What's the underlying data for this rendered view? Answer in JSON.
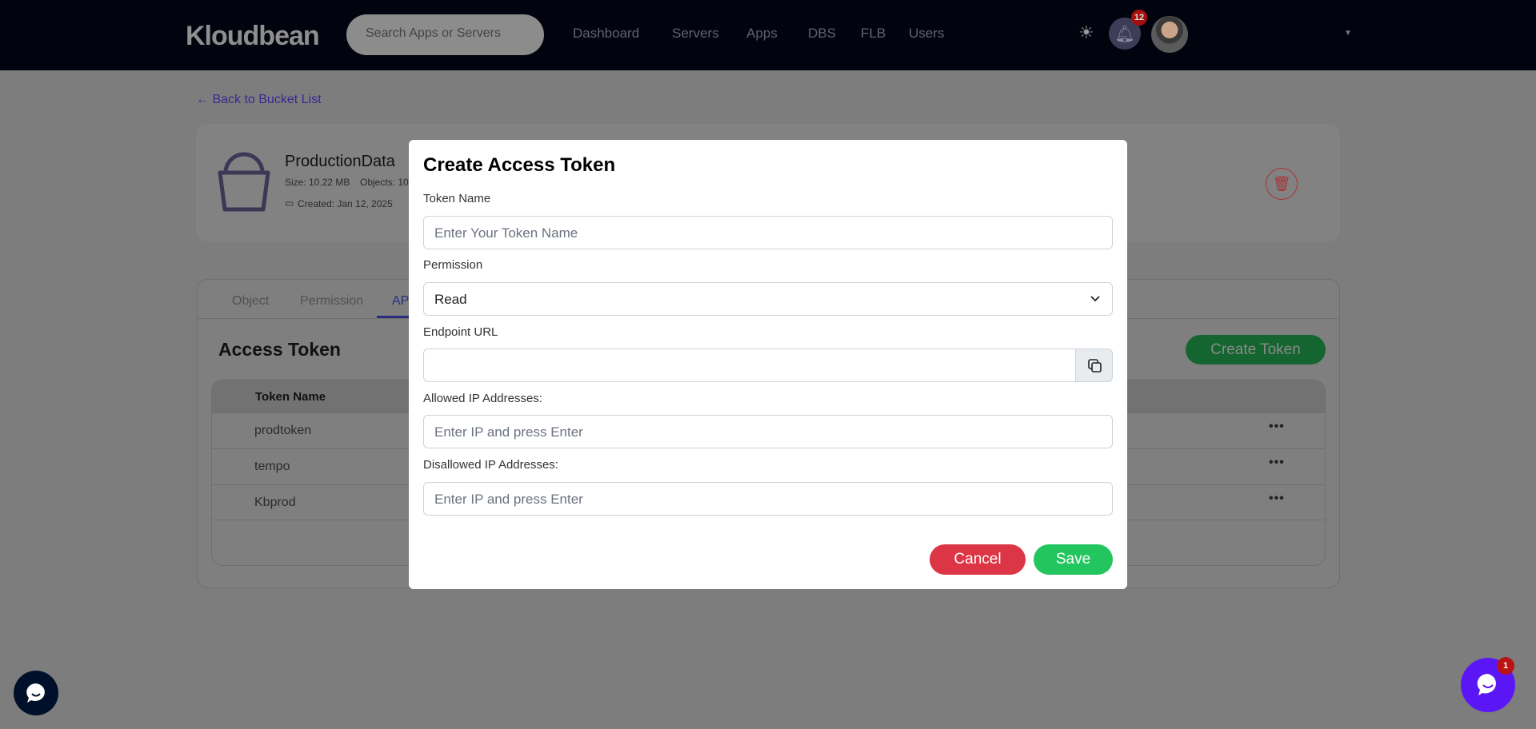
{
  "header": {
    "logo": "Kloudbean",
    "search_placeholder": "Search Apps or Servers",
    "nav": [
      "Dashboard",
      "Servers",
      "Apps",
      "DBS",
      "FLB",
      "Users"
    ],
    "notification_count": "12"
  },
  "back_link": "← Back to Bucket List",
  "bucket": {
    "name": "ProductionData",
    "size": "Size: 10.22 MB",
    "objects": "Objects: 10",
    "created": "Created: Jan 12, 2025"
  },
  "tabs": [
    "Object",
    "Permission",
    "API"
  ],
  "section": {
    "title": "Access Token",
    "create_button": "Create Token",
    "column": "Token Name",
    "tokens": [
      "prodtoken",
      "tempo",
      "Kbprod"
    ]
  },
  "modal": {
    "title": "Create Access Token",
    "token_label": "Token Name",
    "token_placeholder": "Enter Your Token Name",
    "permission_label": "Permission",
    "permission_value": "Read",
    "endpoint_label": "Endpoint URL",
    "endpoint_value": "",
    "allowed_label": "Allowed IP Addresses:",
    "allowed_placeholder": "Enter IP and press Enter",
    "disallowed_label": "Disallowed IP Addresses:",
    "disallowed_placeholder": "Enter IP and press Enter",
    "cancel": "Cancel",
    "save": "Save"
  },
  "chat": {
    "badge": "1"
  },
  "colors": {
    "navbar": "#01040f",
    "cancel": "#dc3545",
    "save": "#22c55e",
    "create": "#166534",
    "chat": "#5b16f5"
  }
}
